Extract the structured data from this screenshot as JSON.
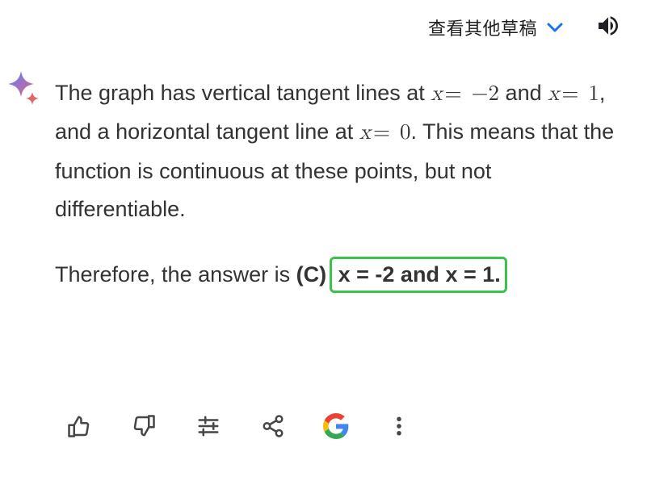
{
  "header": {
    "drafts_label": "查看其他草稿"
  },
  "response": {
    "paragraph_pre_1": "The graph has vertical tangent lines at ",
    "math_x_eq_neg2": {
      "var": "x",
      "eq": "=",
      "neg": "−",
      "num": "2"
    },
    "paragraph_mid_1": " and ",
    "math_x_eq_1": {
      "var": "x",
      "eq": "=",
      "num": "1"
    },
    "paragraph_mid_2": ", and a horizontal tangent line at ",
    "math_x_eq_0": {
      "var": "x",
      "eq": "=",
      "num": "0"
    },
    "paragraph_post_1": ". This means that the function is continuous at these points, but not differentiable.",
    "conclusion_pre": "Therefore, the answer is ",
    "conclusion_choice": "(C)",
    "conclusion_boxed": "x = -2 and x = 1."
  }
}
